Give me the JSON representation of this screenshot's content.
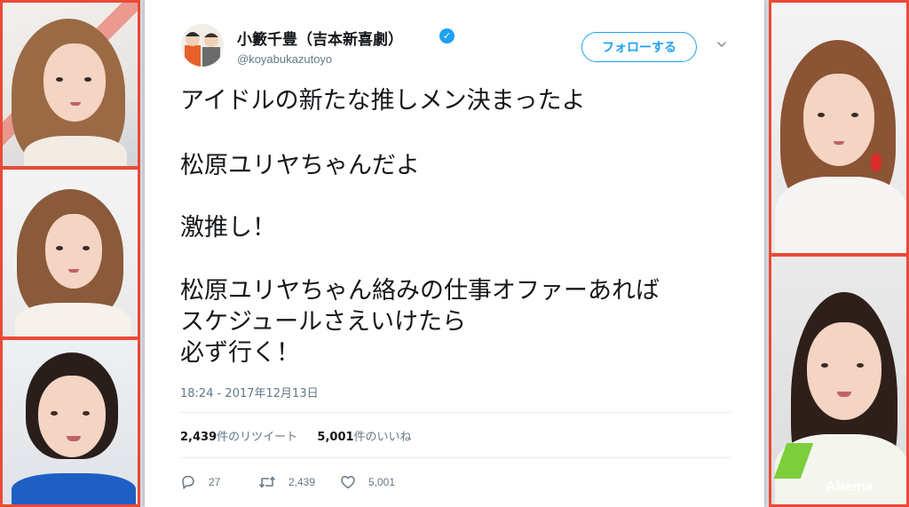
{
  "tweet": {
    "display_name": "小籔千豊（吉本新喜劇）",
    "verified": true,
    "handle": "@koyabukazutoyo",
    "follow_label": "フォローする",
    "lines": [
      "アイドルの新たな推しメン決まったよ",
      "松原ユリヤちゃんだよ",
      "激推し！",
      "松原ユリヤちゃん絡みの仕事オファーあれば",
      "スケジュールさえいけたら",
      "必ず行く！"
    ],
    "timestamp": "18:24 - 2017年12月13日",
    "retweets_count": "2,439",
    "retweets_label": "件のリツイート",
    "likes_count": "5,001",
    "likes_label": "件のいいね",
    "actions": {
      "reply": "27",
      "retweet": "2,439",
      "like": "5,001"
    }
  },
  "watermark": "Abema",
  "colors": {
    "panel_border": "#e94a36",
    "accent": "#1da1f2"
  },
  "icons": [
    "verified-badge-icon",
    "chevron-down-icon",
    "reply-icon",
    "retweet-icon",
    "heart-icon"
  ]
}
